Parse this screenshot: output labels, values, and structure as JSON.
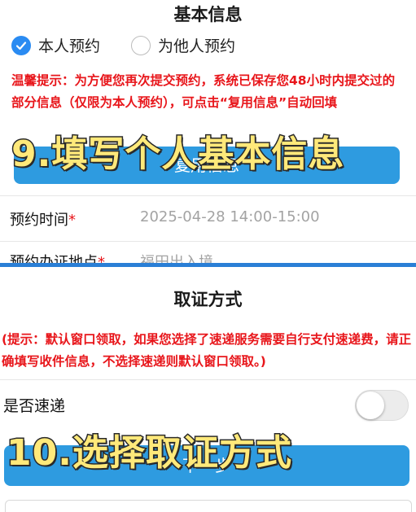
{
  "basic_info": {
    "title": "基本信息",
    "radio_self": "本人预约",
    "radio_other": "为他人预约",
    "tip": "温馨提示：为方便您再次提交预约，系统已保存您48小时内提交过的部分信息（仅限为本人预约），可点击“复用信息”自动回填",
    "reuse_button": "复用信息",
    "time_label": "预约时间",
    "time_value": "2025-04-28 14:00-15:00",
    "place_label": "预约办证地点",
    "place_value": "福田出入境",
    "required_mark": "*"
  },
  "pickup": {
    "title": "取证方式",
    "tip": "(提示：默认窗口领取，如果您选择了速递服务需要自行支付速递费，请正确填写收件信息，不选择速递则默认窗口领取。)",
    "express_label": "是否速递",
    "express_enabled": false,
    "next_button": "下一步"
  },
  "overlays": {
    "step9": "9.填写个人基本信息",
    "step10": "10.选择取证方式"
  },
  "colors": {
    "accent": "#2a8bf2",
    "button": "#2e9be0",
    "warning": "#e8161b",
    "overlay_text": "#ffe97a"
  }
}
